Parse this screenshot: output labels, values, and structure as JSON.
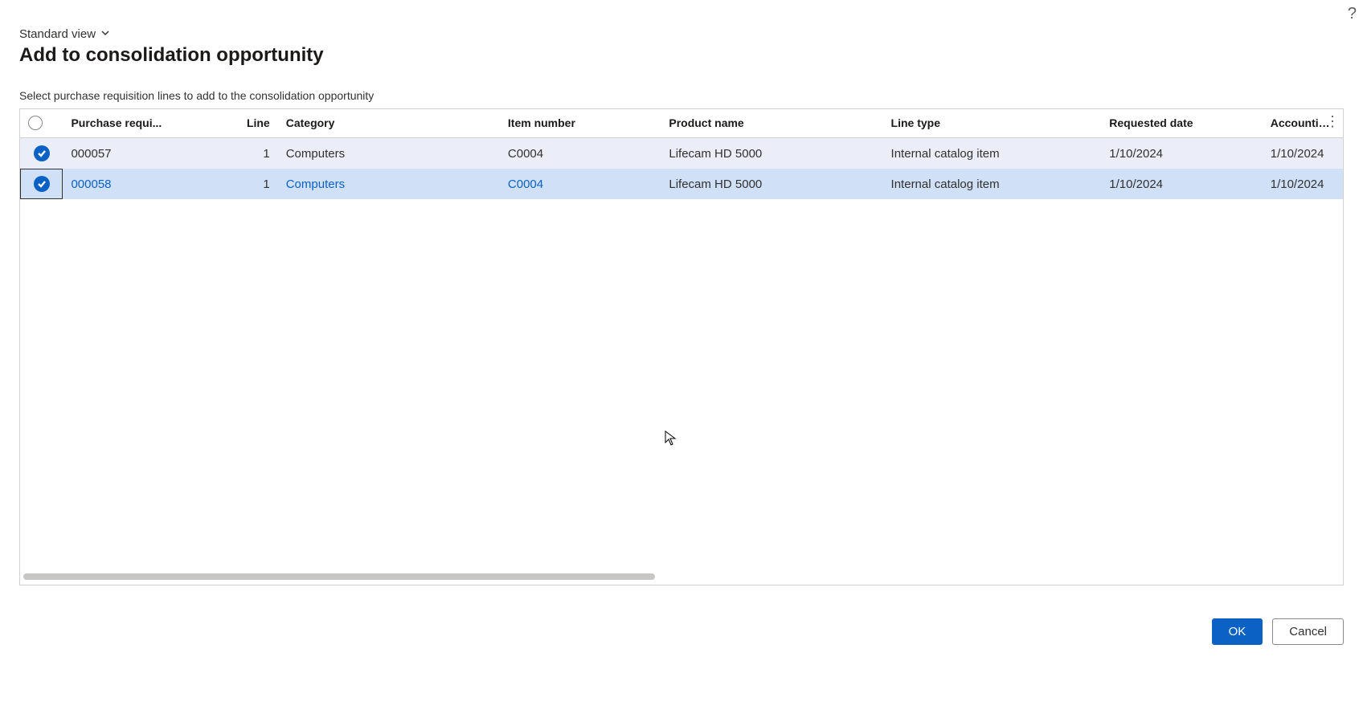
{
  "help_tooltip": "?",
  "view": {
    "label": "Standard view"
  },
  "page_title": "Add to consolidation opportunity",
  "subtitle": "Select purchase requisition lines to add to the consolidation opportunity",
  "columns": {
    "check": "",
    "requisition": "Purchase requi...",
    "line": "Line",
    "category": "Category",
    "item_number": "Item number",
    "product_name": "Product name",
    "line_type": "Line type",
    "requested_date": "Requested date",
    "accounting_date": "Accounting d"
  },
  "rows": [
    {
      "selected": true,
      "focused": false,
      "requisition": "000057",
      "line": "1",
      "category": "Computers",
      "item_number": "C0004",
      "product_name": "Lifecam HD 5000",
      "line_type": "Internal catalog item",
      "requested_date": "1/10/2024",
      "accounting_date": "1/10/2024"
    },
    {
      "selected": true,
      "focused": true,
      "requisition": "000058",
      "line": "1",
      "category": "Computers",
      "item_number": "C0004",
      "product_name": "Lifecam HD 5000",
      "line_type": "Internal catalog item",
      "requested_date": "1/10/2024",
      "accounting_date": "1/10/2024"
    }
  ],
  "buttons": {
    "ok": "OK",
    "cancel": "Cancel"
  }
}
